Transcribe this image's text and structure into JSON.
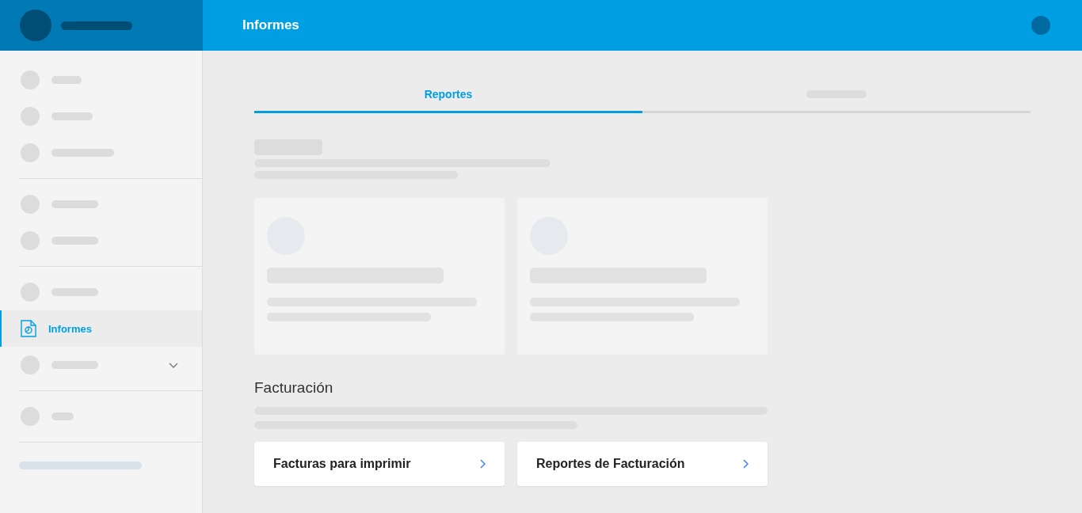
{
  "header": {
    "title": "Informes"
  },
  "sidebar": {
    "groups": [
      {
        "items": [
          {
            "kind": "skeleton"
          },
          {
            "kind": "skeleton"
          },
          {
            "kind": "skeleton"
          }
        ]
      },
      {
        "items": [
          {
            "kind": "skeleton"
          },
          {
            "kind": "skeleton"
          }
        ]
      },
      {
        "items": [
          {
            "kind": "skeleton"
          },
          {
            "kind": "item",
            "label": "Informes",
            "selected": true
          },
          {
            "kind": "skeleton",
            "expandable": true
          }
        ]
      },
      {
        "items": [
          {
            "kind": "skeleton"
          }
        ]
      }
    ]
  },
  "tabs": [
    {
      "kind": "label",
      "label": "Reportes",
      "selected": true
    },
    {
      "kind": "skeleton",
      "selected": false
    }
  ],
  "section": {
    "title": "Facturación",
    "links": [
      {
        "label": "Facturas para imprimir"
      },
      {
        "label": "Reportes de Facturación"
      }
    ]
  }
}
